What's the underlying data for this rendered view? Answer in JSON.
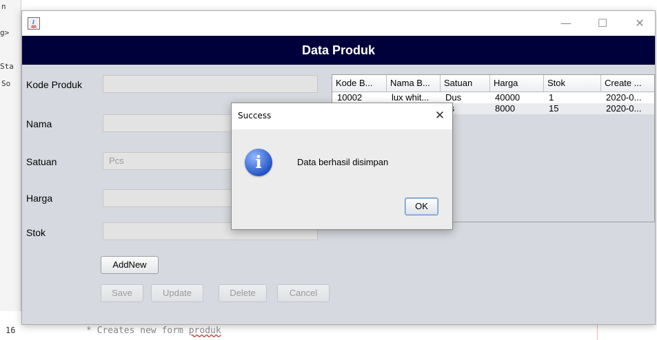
{
  "background": {
    "line_number": "16",
    "code_line_prefix": "* Creates new form ",
    "code_line_word": "produk",
    "left_fragments": [
      "n",
      "g>",
      "Sta",
      "So"
    ]
  },
  "window": {
    "icon": "java-icon",
    "controls": {
      "minimize": "—",
      "maximize": "☐",
      "close": "✕"
    },
    "header_title": "Data Produk",
    "header_color": "#00003a"
  },
  "form": {
    "labels": {
      "kode": "Kode Produk",
      "nama": "Nama",
      "satuan": "Satuan",
      "harga": "Harga",
      "stok": "Stok"
    },
    "satuan_value": "Pcs",
    "buttons": {
      "add_new": "AddNew",
      "save": "Save",
      "update": "Update",
      "delete": "Delete",
      "cancel": "Cancel"
    }
  },
  "table": {
    "columns": [
      "Kode B...",
      "Nama B...",
      "Satuan",
      "Harga",
      "Stok",
      "Create ..."
    ],
    "rows": [
      [
        "10002",
        "lux whit...",
        "Dus",
        "40000",
        "1",
        "2020-0..."
      ],
      [
        "",
        "",
        "cs",
        "8000",
        "15",
        "2020-0..."
      ]
    ]
  },
  "dialog": {
    "title": "Success",
    "close": "✕",
    "icon": "info-icon",
    "icon_glyph": "i",
    "message": "Data berhasil disimpan",
    "ok_label": "OK"
  }
}
